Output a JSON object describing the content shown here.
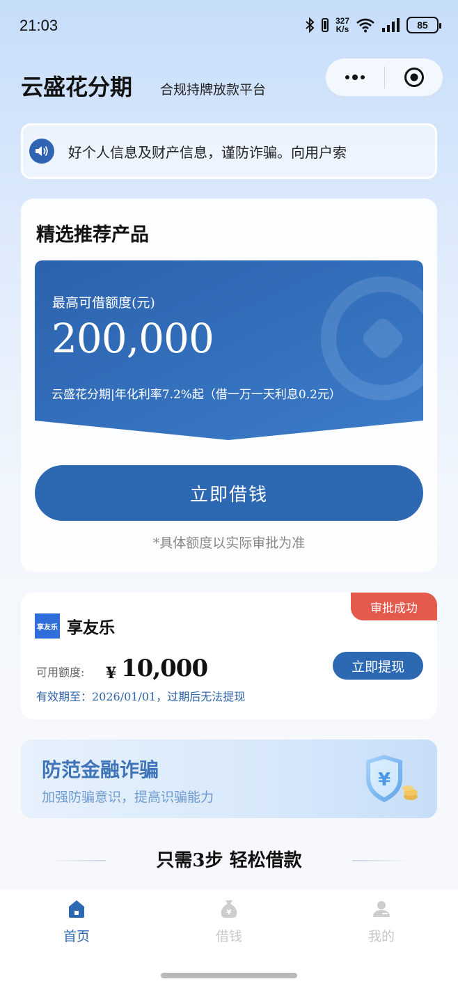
{
  "status_bar": {
    "time": "21:03",
    "net_speed_value": "327",
    "net_speed_unit": "K/s",
    "battery": "85"
  },
  "header": {
    "title": "云盛花分期",
    "subtitle": "合规持牌放款平台"
  },
  "notice": {
    "icon": "speaker-icon",
    "text": "好个人信息及财产信息，谨防诈骗。向用户索"
  },
  "recommend": {
    "title": "精选推荐产品",
    "limit_label": "最高可借额度(元)",
    "limit_value": "200,000",
    "desc": "云盛花分期|年化利率7.2%起（借一万一天利息0.2元）",
    "button": "立即借钱",
    "note": "*具体额度以实际审批为准"
  },
  "product": {
    "badge": "审批成功",
    "logo_text": "享友乐",
    "name": "享友乐",
    "available_label": "可用额度:",
    "currency": "¥",
    "available_value": "10,000",
    "button": "立即提现",
    "validity": "有效期至：2026/01/01，过期后无法提现"
  },
  "fraud_banner": {
    "title": "防范金融诈骗",
    "subtitle": "加强防骗意识，提高识骗能力"
  },
  "steps": {
    "heading": "只需3步 轻松借款"
  },
  "tabbar": {
    "items": [
      {
        "label": "首页",
        "icon": "home-icon",
        "active": true
      },
      {
        "label": "借钱",
        "icon": "money-bag-icon",
        "active": false
      },
      {
        "label": "我的",
        "icon": "user-icon",
        "active": false
      }
    ]
  },
  "colors": {
    "primary": "#2d68b3",
    "badge": "#e45a4d",
    "link_text": "#2f63a8"
  }
}
